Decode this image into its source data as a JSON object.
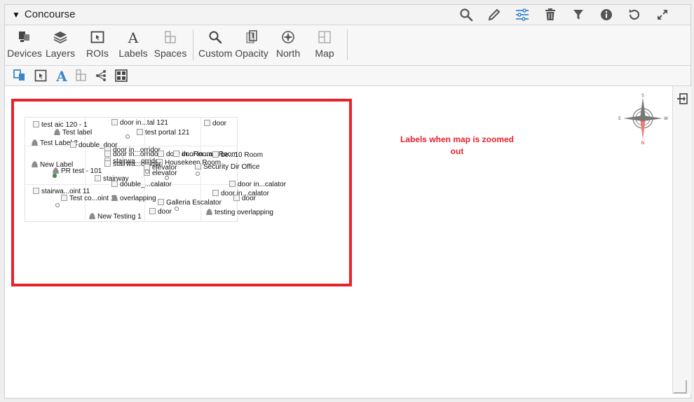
{
  "header": {
    "title": "Concourse",
    "collapse_glyph": "▼",
    "icons": [
      "search-icon",
      "edit-icon",
      "settings-sliders-icon",
      "delete-icon",
      "filter-icon",
      "info-icon",
      "refresh-icon",
      "expand-icon"
    ]
  },
  "toolbar": {
    "items": [
      {
        "label": "Devices",
        "icon": "devices-icon"
      },
      {
        "label": "Layers",
        "icon": "layers-icon"
      },
      {
        "label": "ROIs",
        "icon": "rois-icon"
      },
      {
        "label": "Labels",
        "icon": "labels-icon"
      },
      {
        "label": "Spaces",
        "icon": "spaces-icon"
      },
      {
        "label": "Custom",
        "icon": "custom-search-icon"
      },
      {
        "label": "Opacity",
        "icon": "opacity-icon"
      },
      {
        "label": "North",
        "icon": "north-icon"
      },
      {
        "label": "Map",
        "icon": "map-icon"
      }
    ]
  },
  "toolbar2": {
    "icons": [
      "device-label-icon",
      "roi-label-icon",
      "text-label-icon",
      "space-label-icon",
      "share-icon",
      "grid-icon"
    ]
  },
  "canvas": {
    "annotation": "Labels when map is zoomed out",
    "compass_letters": {
      "n": "N",
      "s": "S",
      "e": "E",
      "w": "W"
    },
    "accent_color": "#e8222b",
    "map_labels": [
      {
        "text": "test aic 120 - 1",
        "kind": "box"
      },
      {
        "text": "door in...tal 121",
        "kind": "box"
      },
      {
        "text": "door",
        "kind": "box"
      },
      {
        "text": "Test label",
        "kind": "person"
      },
      {
        "text": "test portal 121",
        "kind": "box"
      },
      {
        "text": "Test Label 2",
        "kind": "person"
      },
      {
        "text": "double_door",
        "kind": "box"
      },
      {
        "text": "door in...orridor",
        "kind": "box"
      },
      {
        "text": "door in...orridor",
        "kind": "box"
      },
      {
        "text": "door in...Room",
        "kind": "box"
      },
      {
        "text": "door in...ap Room",
        "kind": "box"
      },
      {
        "text": "be...10 Room",
        "kind": "box"
      },
      {
        "text": "stairwa...orridor",
        "kind": "box"
      },
      {
        "text": "Housekeep Room",
        "kind": "box"
      },
      {
        "text": "stairwa...orridor",
        "kind": "box"
      },
      {
        "text": "Security Dir Office",
        "kind": "box"
      },
      {
        "text": "New Label",
        "kind": "person"
      },
      {
        "text": "elevator",
        "kind": "box"
      },
      {
        "text": "PR test - 101",
        "kind": "person"
      },
      {
        "text": "elevator",
        "kind": "box"
      },
      {
        "text": "stairway",
        "kind": "box"
      },
      {
        "text": "double_...calator",
        "kind": "box"
      },
      {
        "text": "door in...calator",
        "kind": "box"
      },
      {
        "text": "stairwa...oint 11",
        "kind": "box"
      },
      {
        "text": "door in...calator",
        "kind": "box"
      },
      {
        "text": "Test co...oint 11",
        "kind": "box"
      },
      {
        "text": "overlapping",
        "kind": "person"
      },
      {
        "text": "door",
        "kind": "box"
      },
      {
        "text": "Galleria Escalator",
        "kind": "box"
      },
      {
        "text": "door",
        "kind": "box"
      },
      {
        "text": "testing overlapping",
        "kind": "person"
      },
      {
        "text": "New Testing 1",
        "kind": "person"
      }
    ]
  }
}
